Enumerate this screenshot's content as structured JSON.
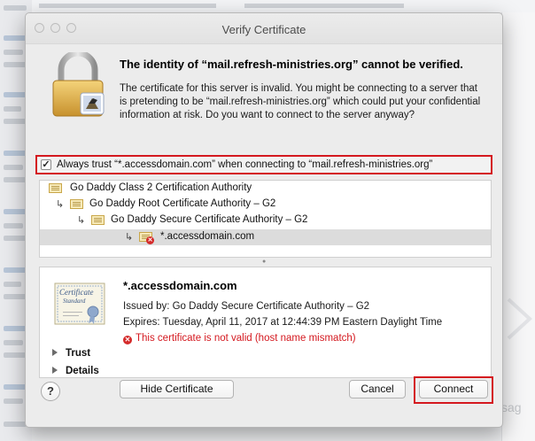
{
  "dialog": {
    "title": "Verify Certificate",
    "headline": "The identity of “mail.refresh-ministries.org” cannot be verified.",
    "message": "The certificate for this server is invalid. You might be connecting to a server that is pretending to be “mail.refresh-ministries.org” which could put your confidential information at risk. Do you want to connect to the server anyway?"
  },
  "trust": {
    "checked": true,
    "label": "Always trust “*.accessdomain.com” when connecting to “mail.refresh-ministries.org”"
  },
  "chain": [
    {
      "label": "Go Daddy Class 2 Certification Authority",
      "level": 0,
      "error": false,
      "selected": false
    },
    {
      "label": "Go Daddy Root Certificate Authority – G2",
      "level": 1,
      "error": false,
      "selected": false
    },
    {
      "label": "Go Daddy Secure Certificate Authority – G2",
      "level": 2,
      "error": false,
      "selected": false
    },
    {
      "label": "*.accessdomain.com",
      "level": 3,
      "error": true,
      "selected": true
    }
  ],
  "details": {
    "cert_image_label_1": "Certificate",
    "cert_image_label_2": "Standard",
    "name": "*.accessdomain.com",
    "issued_by": "Issued by: Go Daddy Secure Certificate Authority – G2",
    "expires": "Expires: Tuesday, April 11, 2017 at 12:44:39 PM Eastern Daylight Time",
    "status": "This certificate is not valid (host name mismatch)",
    "trust_label": "Trust",
    "details_label": "Details"
  },
  "buttons": {
    "help": "?",
    "hide_certificate": "Hide Certificate",
    "cancel": "Cancel",
    "connect": "Connect"
  },
  "background": {
    "right_fragment": "sag"
  },
  "colors": {
    "alert_red": "#d4181f",
    "cert_gold": "#f7eab9"
  }
}
